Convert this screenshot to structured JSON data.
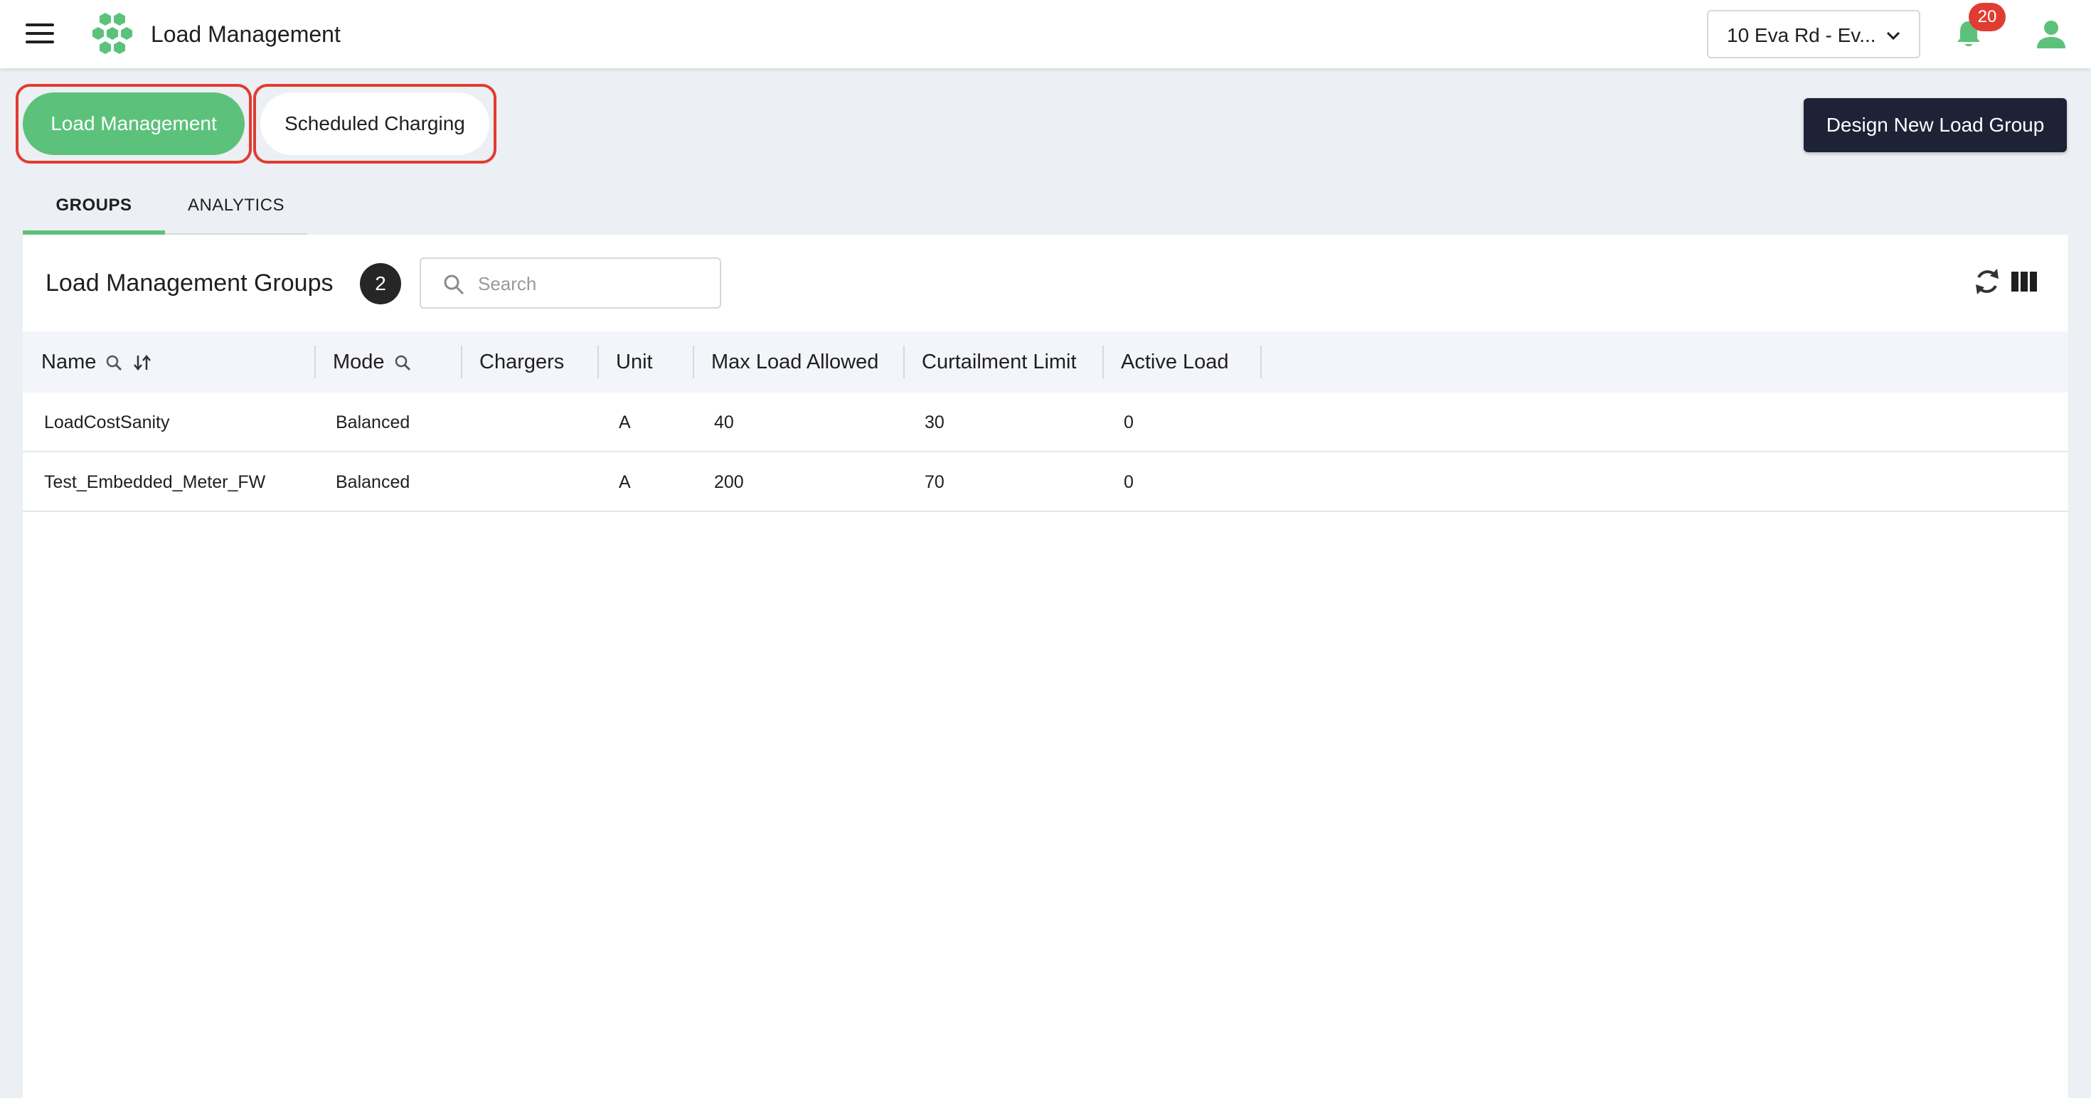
{
  "header": {
    "app_title": "Load Management",
    "site_selector": "10 Eva Rd - Ev...",
    "notification_count": "20"
  },
  "mode_tabs": [
    {
      "label": "Load Management",
      "active": true
    },
    {
      "label": "Scheduled Charging",
      "active": false
    }
  ],
  "actions": {
    "design_button": "Design New Load Group"
  },
  "sub_tabs": [
    {
      "label": "GROUPS",
      "active": true
    },
    {
      "label": "ANALYTICS",
      "active": false
    }
  ],
  "groups_card": {
    "title": "Load Management Groups",
    "count": "2",
    "search_placeholder": "Search",
    "columns": [
      "Name",
      "Mode",
      "Chargers",
      "Unit",
      "Max Load Allowed",
      "Curtailment Limit",
      "Active Load"
    ],
    "rows": [
      {
        "name": "LoadCostSanity",
        "mode": "Balanced",
        "chargers": "",
        "unit": "A",
        "max_load": "40",
        "curtailment": "30",
        "active_load": "0"
      },
      {
        "name": "Test_Embedded_Meter_FW",
        "mode": "Balanced",
        "chargers": "",
        "unit": "A",
        "max_load": "200",
        "curtailment": "70",
        "active_load": "0"
      }
    ]
  },
  "colors": {
    "accent_green": "#5cc27b",
    "dark_button": "#1e2236",
    "badge_red": "#e03c31",
    "highlight_outline": "#e03c31"
  },
  "icons": [
    "menu-icon",
    "hexagon-logo-icon",
    "chevron-down-icon",
    "bell-icon",
    "user-icon",
    "search-icon",
    "refresh-icon",
    "columns-icon",
    "sort-icon"
  ]
}
